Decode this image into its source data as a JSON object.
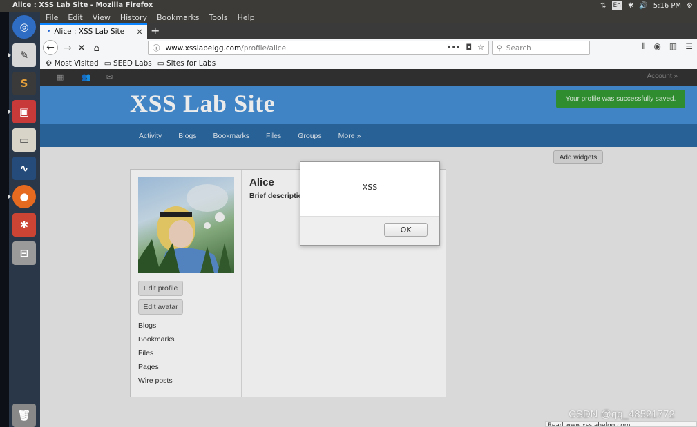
{
  "os": {
    "window_title": "Alice : XSS Lab Site - Mozilla Firefox",
    "input_method": "En",
    "clock": "5:16 PM"
  },
  "browser": {
    "menu": [
      "File",
      "Edit",
      "View",
      "History",
      "Bookmarks",
      "Tools",
      "Help"
    ],
    "tab_title": "Alice : XSS Lab Site",
    "tab_close": "×",
    "new_tab": "+",
    "url_host": "www.xsslabelgg.com",
    "url_path": "/profile/alice",
    "search_placeholder": "Search",
    "bookmarks": [
      "Most Visited",
      "SEED Labs",
      "Sites for Labs"
    ],
    "status_text": "Read www.xsslabelgg.com"
  },
  "site": {
    "account_label": "Account »",
    "title": "XSS Lab Site",
    "saved_message": "Your profile was successfully saved.",
    "nav": [
      "Activity",
      "Blogs",
      "Bookmarks",
      "Files",
      "Groups",
      "More »"
    ],
    "add_widgets": "Add widgets",
    "profile": {
      "name": "Alice",
      "brief_label": "Brief descriptio",
      "edit_profile": "Edit profile",
      "edit_avatar": "Edit avatar",
      "links": [
        "Blogs",
        "Bookmarks",
        "Files",
        "Pages",
        "Wire posts"
      ]
    }
  },
  "alert": {
    "message": "XSS",
    "ok_label": "OK"
  },
  "watermark": "CSDN @qq_48521772",
  "colors": {
    "header_blue": "#4690d6",
    "menu_blue": "#2c6aa3",
    "success_green": "#339933"
  }
}
